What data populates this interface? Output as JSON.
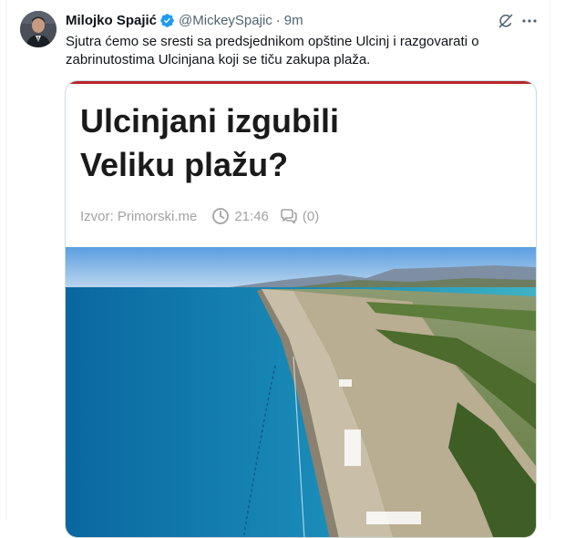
{
  "tweet": {
    "author_name": "Milojko Spajić",
    "handle": "@MickeySpajic",
    "separator": "·",
    "time": "9m",
    "text": "Sjutra ćemo se sresti sa predsjednikom opštine Ulcinj i  razgovarati o zabrinutostima Ulcinjana koji se tiču zakupa plaža."
  },
  "card": {
    "headline_line1": "Ulcinjani izgubili",
    "headline_line2": "Veliku plažu?",
    "source": "Izvor: Primorski.me",
    "time": "21:46",
    "comments": "(0)"
  },
  "icons": [
    "verified-badge-icon",
    "grok-icon",
    "more-icon",
    "clock-icon",
    "comment-icon"
  ],
  "colors": {
    "verified": "#1d9bf0",
    "accent_bar": "#b9252b",
    "meta_text": "#a3a3a3"
  }
}
